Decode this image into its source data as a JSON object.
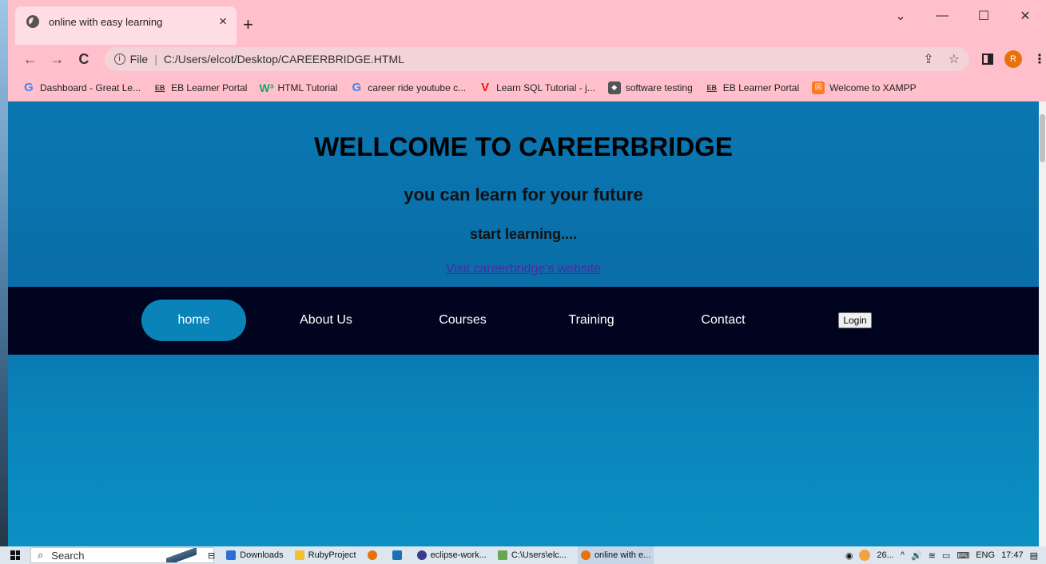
{
  "browser": {
    "tab_title": "online with easy learning",
    "tab_close": "×",
    "new_tab": "+",
    "window_controls": {
      "minimize": "—",
      "maximize": "☐",
      "close": "✕",
      "tabsearch": "⌄"
    },
    "nav": {
      "back": "←",
      "forward": "→",
      "reload": "C"
    },
    "address": {
      "scheme_label": "File",
      "url": "C:/Users/elcot/Desktop/CAREERBRIDGE.HTML"
    },
    "avatar_letter": "R",
    "bookmarks": [
      {
        "label": "Dashboard - Great Le...",
        "icon": "google-icon",
        "glyph": "G"
      },
      {
        "label": "EB Learner Portal",
        "icon": "eb-icon",
        "glyph": "EB"
      },
      {
        "label": "HTML Tutorial",
        "icon": "w3schools-icon",
        "glyph": "W³"
      },
      {
        "label": "career ride youtube c...",
        "icon": "google-icon",
        "glyph": "G"
      },
      {
        "label": "Learn SQL Tutorial - j...",
        "icon": "v-icon",
        "glyph": "V"
      },
      {
        "label": "software testing",
        "icon": "st-icon",
        "glyph": "◆"
      },
      {
        "label": "EB Learner Portal",
        "icon": "eb-icon",
        "glyph": "EB"
      },
      {
        "label": "Welcome to XAMPP",
        "icon": "xampp-icon",
        "glyph": "☒"
      }
    ]
  },
  "page": {
    "heading": "WELLCOME TO CAREERBRIDGE",
    "subheading": "you can learn for your future",
    "tagline": "start learning....",
    "link_text": "Visit careerbridge's website",
    "nav": [
      {
        "label": "home",
        "active": true
      },
      {
        "label": "About Us",
        "active": false
      },
      {
        "label": "Courses",
        "active": false
      },
      {
        "label": "Training",
        "active": false
      },
      {
        "label": "Contact",
        "active": false
      }
    ],
    "login_label": "Login"
  },
  "taskbar": {
    "search_label": "Search",
    "items": [
      {
        "label": "Downloads",
        "color": "#2b6fd6"
      },
      {
        "label": "RubyProject",
        "color": "#f2c230"
      },
      {
        "label": "",
        "color": "#e8710a"
      },
      {
        "label": "",
        "color": "#1f6fb5"
      },
      {
        "label": "eclipse-work...",
        "color": "#3b3b8f"
      },
      {
        "label": "C:\\Users\\elc...",
        "color": "#6aa84f"
      },
      {
        "label": "online with e...",
        "color": "#e8710a"
      }
    ],
    "weather": "26...",
    "lang": "ENG",
    "time": "17:47"
  },
  "colors": {
    "chrome_bg": "#ffc0cb",
    "page_bg": "#0a6ea8",
    "navbar_bg": "#01041f",
    "nav_active": "#0a84b8",
    "link": "#4b2aa0"
  }
}
